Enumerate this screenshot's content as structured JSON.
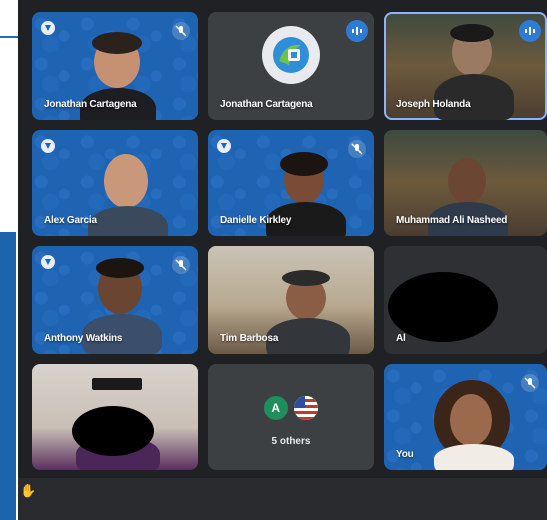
{
  "participants": [
    {
      "name": "Jonathan Cartagena",
      "muted": true
    },
    {
      "name": "Jonathan Cartagena",
      "speaking": true
    },
    {
      "name": "Joseph Holanda"
    },
    {
      "name": "Alex Garcia",
      "muted": true
    },
    {
      "name": "Danielle Kirkley",
      "muted": true
    },
    {
      "name": "Muhammad Ali Nasheed"
    },
    {
      "name": "Anthony Watkins",
      "muted": true
    },
    {
      "name": "Tim Barbosa"
    },
    {
      "name": "Al"
    },
    {
      "name": ""
    },
    {
      "name": "You"
    }
  ],
  "others": {
    "avatar_letter": "A",
    "label": "5 others"
  },
  "colors": {
    "accent": "#8ab4f8",
    "tile_blue": "#1f64b3",
    "background": "#202124"
  }
}
